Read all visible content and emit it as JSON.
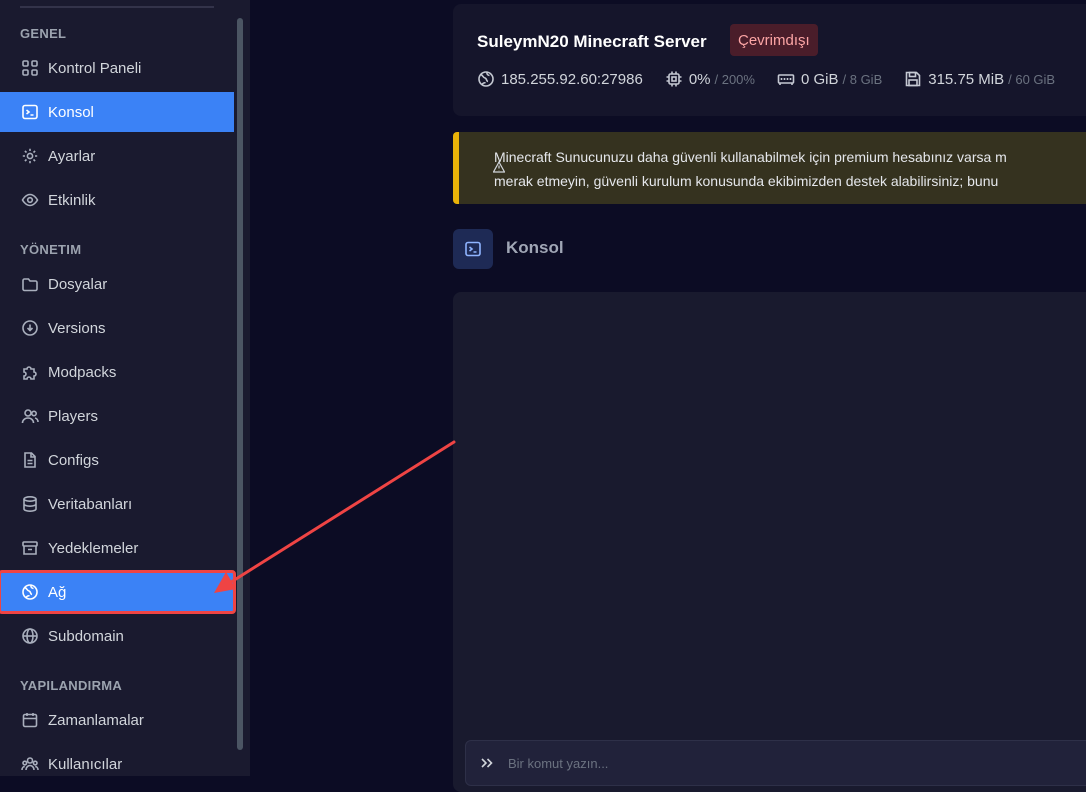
{
  "sidebar": {
    "sections": [
      {
        "title": "GENEL"
      },
      {
        "title": "YÖNETIM"
      },
      {
        "title": "YAPILANDIRMA"
      }
    ],
    "items": [
      {
        "label": "Kontrol Paneli",
        "icon": "dashboard-icon"
      },
      {
        "label": "Konsol",
        "icon": "terminal-icon",
        "active": true
      },
      {
        "label": "Ayarlar",
        "icon": "gear-icon"
      },
      {
        "label": "Etkinlik",
        "icon": "eye-icon"
      },
      {
        "label": "Dosyalar",
        "icon": "folder-icon"
      },
      {
        "label": "Versions",
        "icon": "download-circle-icon"
      },
      {
        "label": "Modpacks",
        "icon": "puzzle-icon"
      },
      {
        "label": "Players",
        "icon": "users-icon"
      },
      {
        "label": "Configs",
        "icon": "document-icon"
      },
      {
        "label": "Veritabanları",
        "icon": "database-icon"
      },
      {
        "label": "Yedeklemeler",
        "icon": "archive-icon"
      },
      {
        "label": "Ağ",
        "icon": "network-globe-icon",
        "highlighted": true
      },
      {
        "label": "Subdomain",
        "icon": "globe-icon"
      },
      {
        "label": "Zamanlamalar",
        "icon": "calendar-icon"
      },
      {
        "label": "Kullanıcılar",
        "icon": "user-group-icon"
      }
    ]
  },
  "server": {
    "name": "SuleymN20 Minecraft Server",
    "status": "Çevrimdışı",
    "address": "185.255.92.60:27986",
    "cpu": "0%",
    "cpu_limit": "/ 200%",
    "memory": "0 GiB",
    "memory_limit": "/ 8 GiB",
    "disk": "315.75 MiB",
    "disk_limit": "/ 60 GiB"
  },
  "alert": {
    "line1": "Minecraft Sunucunuzu daha güvenli kullanabilmek için premium hesabınız varsa m",
    "line2": "merak etmeyin, güvenli kurulum konusunda ekibimizden destek alabilirsiniz; bunu"
  },
  "console": {
    "title": "Konsol",
    "placeholder": "Bir komut yazın..."
  },
  "colors": {
    "accent": "#3b82f6",
    "annotation": "#ef4444",
    "offline_badge": "#4a1d2a",
    "alert_border": "#eab308"
  }
}
